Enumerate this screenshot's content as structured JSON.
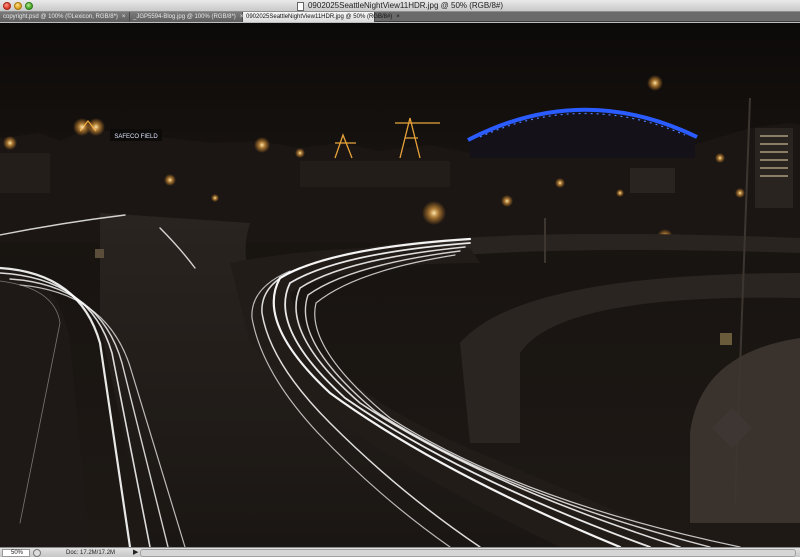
{
  "window": {
    "title": "0902025SeattleNightView11HDR.jpg @ 50% (RGB/8#)"
  },
  "tabs": [
    {
      "label": "copyright.psd @ 100% (©Lexicon, RGB/8*)",
      "close": "×",
      "active": false
    },
    {
      "label": "_JGP5594-Blog.jpg @ 100% (RGB/8*)",
      "close": "×",
      "active": false
    },
    {
      "label": "0902025SeattleNightView11HDR.jpg @ 50% (RGB/8#)",
      "close": "×",
      "active": true
    }
  ],
  "canvas": {
    "image_description_icon": "photo-canvas",
    "sign_text": "SAFECO FIELD"
  },
  "statusbar": {
    "zoom": "50%",
    "doc_info": "Doc: 17.2M/17.2M",
    "arrow": "▶"
  },
  "colors": {
    "stadium_arch": "#2a5cff",
    "light_trail": "#ffffff",
    "sky": "#0e0c0a"
  }
}
